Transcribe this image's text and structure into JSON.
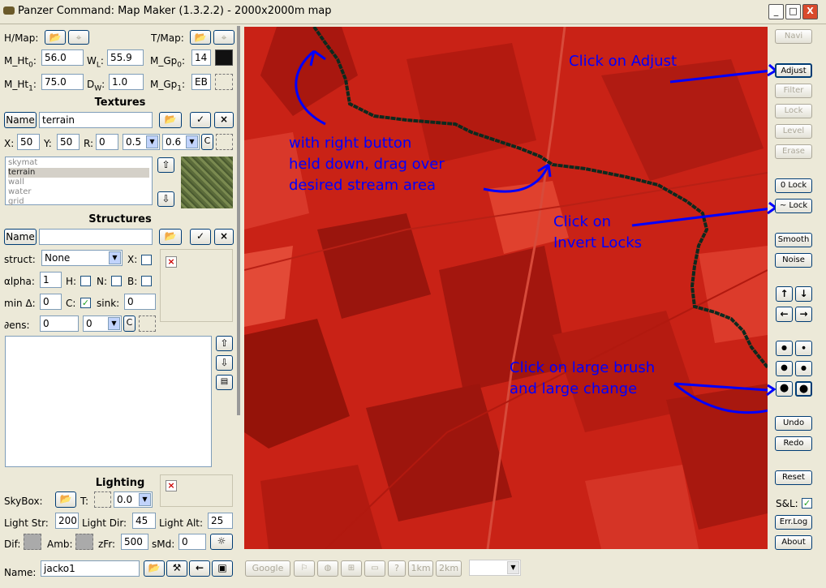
{
  "window": {
    "title": "Panzer Command: Map Maker (1.3.2.2) - 2000x2000m map",
    "min": "_",
    "max": "□",
    "close": "X"
  },
  "heightmap": {
    "hmap_label": "H/Map:",
    "tmap_label": "T/Map:",
    "mht0_label": "M_Ht",
    "mht0_sub": "0",
    "mht0_val": "56.0",
    "wl_label": "W",
    "wl_sub": "L",
    "wl_val": "55.9",
    "mgp0_label": "M_Gp",
    "mgp0_sub": "0",
    "mgp0_val": "14",
    "mht1_label": "M_Ht",
    "mht1_sub": "1",
    "mht1_val": "75.0",
    "dw_label": "D",
    "dw_sub": "W",
    "dw_val": "1.0",
    "mgp1_label": "M_Gp",
    "mgp1_sub": "1",
    "mgp1_val": "EB"
  },
  "textures": {
    "heading": "Textures",
    "name_button": "Name",
    "name_val": "terrain",
    "ok": "✓",
    "x": "×",
    "x_label": "X:",
    "x_val": "50",
    "y_label": "Y:",
    "y_val": "50",
    "r_label": "R:",
    "r_val": "0",
    "sel1": "0.5",
    "sel2": "0.6",
    "c_button": "C",
    "list": [
      "skymat",
      "terrain",
      "wall",
      "water",
      "grid"
    ],
    "selected": "terrain"
  },
  "structures": {
    "heading": "Structures",
    "name_button": "Name",
    "name_val": "",
    "ok": "✓",
    "x": "×",
    "struct_label": "struct:",
    "struct_val": "None",
    "x_chk": "X:",
    "alpha_label": "αlpha:",
    "alpha_val": "1",
    "h_label": "H:",
    "n_label": "N:",
    "b_label": "B:",
    "mind_label": "min Δ:",
    "mind_val": "0",
    "c_label": "C:",
    "c_checked": "✓",
    "sink_label": "sink:",
    "sink_val": "0",
    "dens_label": "∂ens:",
    "dens_val": "0",
    "dens_sel": "0",
    "c_button": "C"
  },
  "lighting": {
    "heading": "Lighting",
    "skybox_label": "SkyBox:",
    "t_label": "T:",
    "t_sel": "0.0",
    "str_label": "Light Str:",
    "str_val": "200",
    "dir_label": "Light Dir:",
    "dir_val": "45",
    "alt_label": "Light Alt:",
    "alt_val": "25",
    "dif_label": "Dif:",
    "amb_label": "Amb:",
    "zfr_label": "zFr:",
    "zfr_val": "500",
    "smd_label": "sMd:",
    "smd_val": "0"
  },
  "footer": {
    "name_label": "Name:",
    "name_val": "jacko1"
  },
  "right_panel": {
    "navi": "Navi",
    "adjust": "Adjust",
    "filter": "Filter",
    "lock": "Lock",
    "level": "Level",
    "erase": "Erase",
    "zero_lock": "0 Lock",
    "inv_lock": "~ Lock",
    "smooth": "Smooth",
    "noise": "Noise",
    "up": "↑",
    "down": "↓",
    "left": "←",
    "right": "→",
    "undo": "Undo",
    "redo": "Redo",
    "reset": "Reset",
    "sl_label": "S&L:",
    "sl_check": "✓",
    "errlog": "Err.Log",
    "about": "About"
  },
  "bottom_bar": {
    "google": "Google",
    "b1km": "1km",
    "b2km": "2km",
    "q": "?"
  },
  "annotations": {
    "adjust": "Click on Adjust",
    "stream_1": "with right button",
    "stream_2": "held down, drag over",
    "stream_3": "desired stream area",
    "invert_1": "Click on",
    "invert_2": "Invert Locks",
    "brush_1": "Click on large brush",
    "brush_2": "and large change"
  },
  "colors": {
    "map_red": "#c41f14",
    "annotation": "#0000ff",
    "lock_line": "#0d2a1e"
  }
}
